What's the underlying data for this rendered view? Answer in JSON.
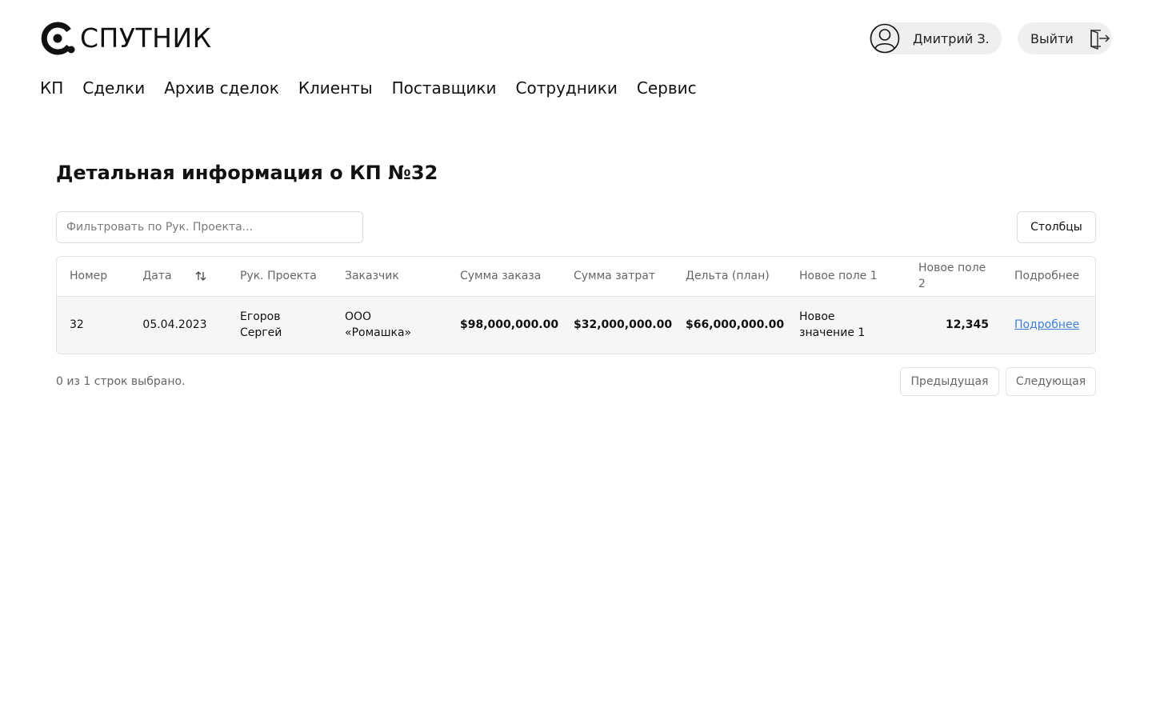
{
  "header": {
    "logo_text": "СПУТНИК",
    "user_name": "Дмитрий З.",
    "logout_label": "Выйти"
  },
  "nav": {
    "items": [
      "КП",
      "Сделки",
      "Архив сделок",
      "Клиенты",
      "Поставщики",
      "Сотрудники",
      "Сервис"
    ]
  },
  "page": {
    "title": "Детальная информация о КП №32"
  },
  "filter": {
    "placeholder": "Фильтровать по Рук. Проекта..."
  },
  "toolbar": {
    "columns_label": "Столбцы"
  },
  "table": {
    "headers": [
      "Номер",
      "Дата",
      "Рук. Проекта",
      "Заказчик",
      "Сумма заказа",
      "Сумма затрат",
      "Дельта (план)",
      "Новое поле 1",
      "Новое поле 2",
      "Подробнее"
    ],
    "rows": [
      {
        "number": "32",
        "date": "05.04.2023",
        "manager": "Егоров Сергей",
        "customer": "ООО «Ромашка»",
        "order_sum": "$98,000,000.00",
        "cost_sum": "$32,000,000.00",
        "delta": "$66,000,000.00",
        "field1": "Новое значение 1",
        "field2": "12,345",
        "details": "Подробнее"
      }
    ]
  },
  "footer": {
    "selected_text": "0 из 1 строк выбрано.",
    "prev_label": "Предыдущая",
    "next_label": "Следующая"
  },
  "colors": {
    "link": "#3d7fd9",
    "pill_bg": "#efefef",
    "row_bg": "#f6f6f6",
    "border": "#e2e2e2"
  },
  "icons": {
    "logo": "sputnik-logo-icon",
    "avatar": "user-avatar-icon",
    "logout": "logout-door-icon",
    "sort": "sort-arrows-icon"
  }
}
